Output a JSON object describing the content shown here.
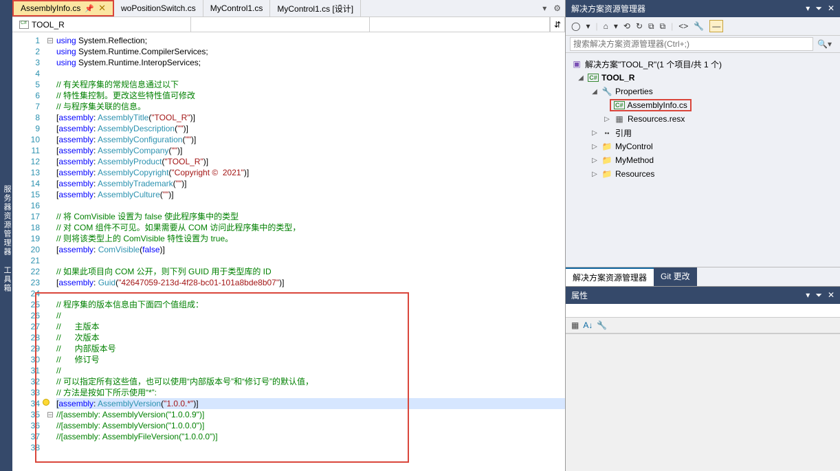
{
  "leftLabel": "服务器资源管理器 工具箱",
  "tabs": {
    "active": "AssemblyInfo.cs",
    "t2": "woPositionSwitch.cs",
    "t3": "MyControl1.cs",
    "t4": "MyControl1.cs [设计]"
  },
  "navBar": "TOOL_R",
  "code": [
    {
      "n": 1,
      "fold": "⊟",
      "html": "<span class='kw'>using</span> <span class='ident'>System.Reflection</span><span class='punct'>;</span>"
    },
    {
      "n": 2,
      "html": "<span class='kw'>using</span> <span class='ident'>System.Runtime.CompilerServices</span><span class='punct'>;</span>"
    },
    {
      "n": 3,
      "html": "<span class='kw'>using</span> <span class='ident'>System.Runtime.InteropServices</span><span class='punct'>;</span>"
    },
    {
      "n": 4,
      "html": ""
    },
    {
      "n": 5,
      "html": "<span class='comment'>// 有关程序集的常规信息通过以下</span>"
    },
    {
      "n": 6,
      "html": "<span class='comment'>// 特性集控制。更改这些特性值可修改</span>"
    },
    {
      "n": 7,
      "html": "<span class='comment'>// 与程序集关联的信息。</span>"
    },
    {
      "n": 8,
      "html": "<span class='punct'>[</span><span class='kw'>assembly</span><span class='punct'>: </span><span class='type'>AssemblyTitle</span><span class='punct'>(</span><span class='str'>\"TOOL_R\"</span><span class='punct'>)]</span>"
    },
    {
      "n": 9,
      "html": "<span class='punct'>[</span><span class='kw'>assembly</span><span class='punct'>: </span><span class='type'>AssemblyDescription</span><span class='punct'>(</span><span class='str'>\"\"</span><span class='punct'>)]</span>"
    },
    {
      "n": 10,
      "html": "<span class='punct'>[</span><span class='kw'>assembly</span><span class='punct'>: </span><span class='type'>AssemblyConfiguration</span><span class='punct'>(</span><span class='str'>\"\"</span><span class='punct'>)]</span>"
    },
    {
      "n": 11,
      "html": "<span class='punct'>[</span><span class='kw'>assembly</span><span class='punct'>: </span><span class='type'>AssemblyCompany</span><span class='punct'>(</span><span class='str'>\"\"</span><span class='punct'>)]</span>"
    },
    {
      "n": 12,
      "html": "<span class='punct'>[</span><span class='kw'>assembly</span><span class='punct'>: </span><span class='type'>AssemblyProduct</span><span class='punct'>(</span><span class='str'>\"TOOL_R\"</span><span class='punct'>)]</span>"
    },
    {
      "n": 13,
      "html": "<span class='punct'>[</span><span class='kw'>assembly</span><span class='punct'>: </span><span class='type'>AssemblyCopyright</span><span class='punct'>(</span><span class='str'>\"Copyright ©  2021\"</span><span class='punct'>)]</span>"
    },
    {
      "n": 14,
      "html": "<span class='punct'>[</span><span class='kw'>assembly</span><span class='punct'>: </span><span class='type'>AssemblyTrademark</span><span class='punct'>(</span><span class='str'>\"\"</span><span class='punct'>)]</span>"
    },
    {
      "n": 15,
      "html": "<span class='punct'>[</span><span class='kw'>assembly</span><span class='punct'>: </span><span class='type'>AssemblyCulture</span><span class='punct'>(</span><span class='str'>\"\"</span><span class='punct'>)]</span>"
    },
    {
      "n": 16,
      "html": ""
    },
    {
      "n": 17,
      "html": "<span class='comment'>// 将 ComVisible 设置为 false 使此程序集中的类型</span>"
    },
    {
      "n": 18,
      "html": "<span class='comment'>// 对 COM 组件不可见。如果需要从 COM 访问此程序集中的类型，</span>"
    },
    {
      "n": 19,
      "html": "<span class='comment'>// 则将该类型上的 ComVisible 特性设置为 true。</span>"
    },
    {
      "n": 20,
      "html": "<span class='punct'>[</span><span class='kw'>assembly</span><span class='punct'>: </span><span class='type'>ComVisible</span><span class='punct'>(</span><span class='kw'>false</span><span class='punct'>)]</span>"
    },
    {
      "n": 21,
      "html": ""
    },
    {
      "n": 22,
      "html": "<span class='comment'>// 如果此项目向 COM 公开，则下列 GUID 用于类型库的 ID</span>"
    },
    {
      "n": 23,
      "html": "<span class='punct'>[</span><span class='kw'>assembly</span><span class='punct'>: </span><span class='type'>Guid</span><span class='punct'>(</span><span class='str'>\"42647059-213d-4f28-bc01-101a8bde8b07\"</span><span class='punct'>)]</span>"
    },
    {
      "n": 24,
      "html": ""
    },
    {
      "n": 25,
      "html": "<span class='comment'>// 程序集的版本信息由下面四个值组成：</span>"
    },
    {
      "n": 26,
      "html": "<span class='comment'>//</span>"
    },
    {
      "n": 27,
      "html": "<span class='comment'>//      主版本</span>"
    },
    {
      "n": 28,
      "html": "<span class='comment'>//      次版本</span>"
    },
    {
      "n": 29,
      "html": "<span class='comment'>//      内部版本号</span>"
    },
    {
      "n": 30,
      "html": "<span class='comment'>//      修订号</span>"
    },
    {
      "n": 31,
      "html": "<span class='comment'>//</span>"
    },
    {
      "n": 32,
      "html": "<span class='comment'>// 可以指定所有这些值，也可以使用“内部版本号”和“修订号”的默认值，</span>"
    },
    {
      "n": 33,
      "html": "<span class='comment'>// 方法是按如下所示使用“*”:</span>"
    },
    {
      "n": 34,
      "bulb": true,
      "sel": true,
      "html": "<span class='punct'>[</span><span class='kw'>assembly</span><span class='punct'>: </span><span class='type'>AssemblyVersion</span><span class='punct'>(</span><span class='str'>\"1.0.0.*\"</span><span class='punct'>)]</span>"
    },
    {
      "n": 35,
      "fold": "⊟",
      "html": "<span class='comment'>//[assembly: AssemblyVersion(\"1.0.0.9\")]</span>"
    },
    {
      "n": 36,
      "html": "<span class='comment'>//[assembly: AssemblyVersion(\"1.0.0.0\")]</span>"
    },
    {
      "n": 37,
      "html": "<span class='comment'>//[assembly: AssemblyFileVersion(\"1.0.0.0\")]</span>"
    },
    {
      "n": 38,
      "html": ""
    }
  ],
  "solutionExplorer": {
    "title": "解决方案资源管理器",
    "searchPlaceholder": "搜索解决方案资源管理器(Ctrl+;)",
    "solutionText": "解决方案\"TOOL_R\"(1 个项目/共 1 个)",
    "project": "TOOL_R",
    "properties": "Properties",
    "assemblyInfo": "AssemblyInfo.cs",
    "resx": "Resources.resx",
    "references": "引用",
    "f1": "MyControl",
    "f2": "MyMethod",
    "f3": "Resources"
  },
  "bottomTabs": {
    "active": "解决方案资源管理器",
    "git": "Git 更改"
  },
  "properties": {
    "title": "属性"
  }
}
